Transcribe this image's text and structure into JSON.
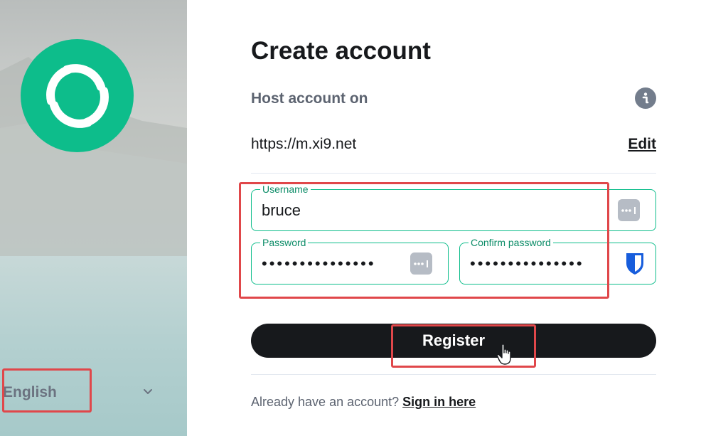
{
  "language": {
    "selected": "English"
  },
  "form": {
    "title": "Create account",
    "host_label": "Host account on",
    "server_url": "https://m.xi9.net",
    "edit_label": "Edit",
    "username": {
      "label": "Username",
      "value": "bruce"
    },
    "password": {
      "label": "Password",
      "value": "•••••••••••••••"
    },
    "confirm_password": {
      "label": "Confirm password",
      "value": "•••••••••••••••"
    },
    "register_label": "Register",
    "signin_prompt": "Already have an account?",
    "signin_link": "Sign in here"
  },
  "colors": {
    "accent": "#0dbd8b",
    "button": "#17191c",
    "highlight": "#e0474a",
    "bitwarden": "#175ddc"
  },
  "icons": [
    "element-logo-icon",
    "chevron-down-icon",
    "info-icon",
    "password-manager-icon",
    "bitwarden-shield-icon",
    "hand-cursor-icon"
  ]
}
